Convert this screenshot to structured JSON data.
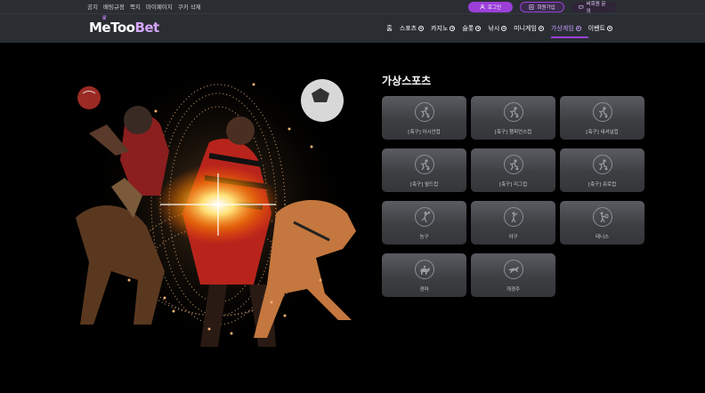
{
  "topbar": {
    "links": [
      "공지",
      "배팅규정",
      "쪽지",
      "마이페이지",
      "쿠키 삭제"
    ],
    "buttons": {
      "login": "로그인",
      "join": "회원가입",
      "guest": "비회원 문의"
    }
  },
  "logo": {
    "part1": "MeToo",
    "part2": "Bet"
  },
  "nav": {
    "items": [
      "홈",
      "스포츠",
      "카지노",
      "슬롯",
      "낚시",
      "미니게임",
      "가상게임",
      "이벤트"
    ],
    "active": "가상게임"
  },
  "section": {
    "title": "가상스포츠",
    "cards": [
      {
        "label": "[축구] 아시안컵",
        "icon": "soccer-icon"
      },
      {
        "label": "[축구] 챔피언스컵",
        "icon": "soccer-icon"
      },
      {
        "label": "[축구] 내셔널컵",
        "icon": "soccer-icon"
      },
      {
        "label": "[축구] 월드컵",
        "icon": "soccer-icon"
      },
      {
        "label": "[축구] 리그컵",
        "icon": "soccer-icon"
      },
      {
        "label": "[축구] 유로컵",
        "icon": "soccer-icon"
      },
      {
        "label": "농구",
        "icon": "basketball-icon"
      },
      {
        "label": "야구",
        "icon": "baseball-icon"
      },
      {
        "label": "테니스",
        "icon": "tennis-icon"
      },
      {
        "label": "경마",
        "icon": "horse-racing-icon"
      },
      {
        "label": "개경주",
        "icon": "greyhound-icon"
      }
    ]
  },
  "colors": {
    "accent": "#9b3fd8",
    "bar": "#2a2e33",
    "card": "#4a4c50"
  }
}
